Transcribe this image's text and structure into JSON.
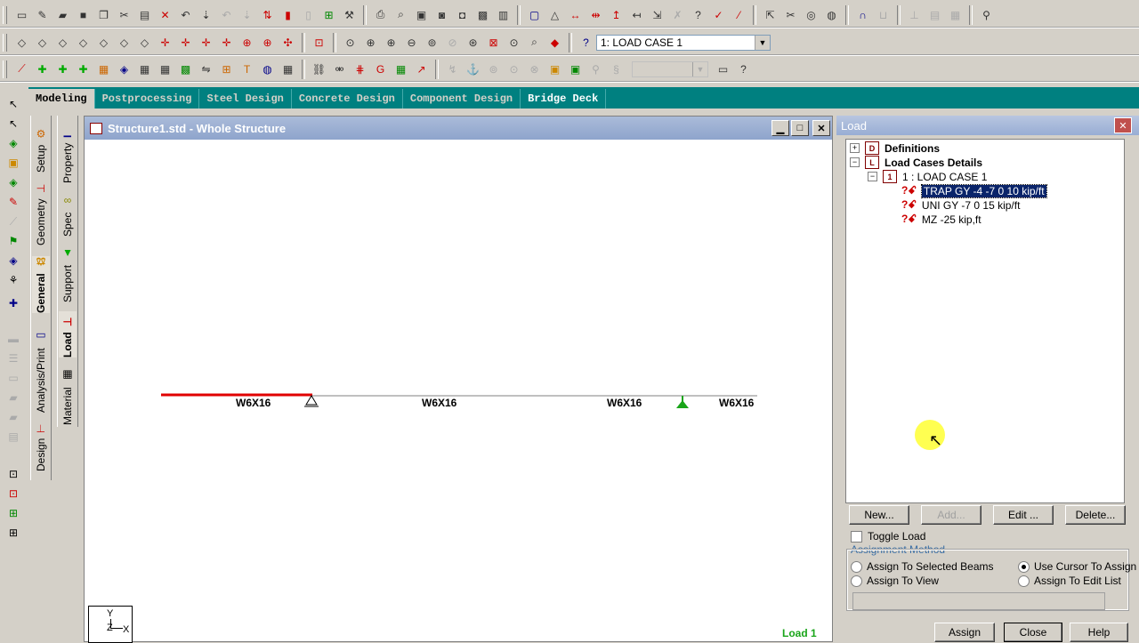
{
  "toolbar": {
    "load_case_select": "1: LOAD CASE 1",
    "icons_row1": [
      "new-file",
      "open-file",
      "open-folder",
      "save",
      "copy-doc",
      "cut",
      "paste",
      "delete",
      "undo",
      "redo-arrow",
      "undo2",
      "redo2",
      "sort",
      "clipboard",
      "list",
      "grid",
      "hammer",
      "print",
      "print-preview",
      "fax",
      "camera",
      "camera2",
      "video",
      "report",
      "window",
      "triangle-shape",
      "node-arrows",
      "dimension",
      "dimension2",
      "dimension3",
      "dimension4",
      "question",
      "chart",
      "chart2",
      "cursor",
      "scissors",
      "disk",
      "ring",
      "pipe",
      "boxes",
      "boxes2",
      "cube",
      "light"
    ],
    "icons_row2": [
      "cube1",
      "cube2",
      "cube3",
      "cube4",
      "cube5",
      "cube6",
      "pan1",
      "pan2",
      "pan3",
      "pan4",
      "pan5",
      "select-area",
      "dash",
      "fit",
      "zoom-in",
      "zoom-in2",
      "zoom-out",
      "zoom-window",
      "zoom-dynamic",
      "zoom-prev",
      "zoom-all",
      "zoom-sel",
      "zoom-field",
      "paint",
      "help-dropdown"
    ],
    "icons_row3": [
      "add-beam",
      "add-node",
      "add-plate",
      "add-solid",
      "mesh",
      "move",
      "rotate",
      "mirror",
      "split",
      "merge",
      "insert",
      "text",
      "globe",
      "table",
      "tool1",
      "tool2",
      "tool3",
      "tool4",
      "tool5",
      "tool6",
      "tool7",
      "tool8",
      "tool9",
      "tool10",
      "tool11",
      "tool12",
      "tool13",
      "tool14",
      "tool15",
      "monitor",
      "help"
    ]
  },
  "page_tabs": [
    {
      "label": "Modeling",
      "active": true
    },
    {
      "label": "Postprocessing"
    },
    {
      "label": "Steel Design"
    },
    {
      "label": "Concrete Design"
    },
    {
      "label": "Component Design"
    },
    {
      "label": "Bridge Deck",
      "bright": true
    }
  ],
  "side_tabs_outer": [
    "Setup",
    "Geometry",
    "General",
    "Analysis/Print",
    "Design"
  ],
  "side_tabs_inner": [
    "Property",
    "Spec",
    "Support",
    "Load",
    "Material"
  ],
  "structure_window": {
    "title": "Structure1.std - Whole Structure",
    "beam_labels": [
      "W6X16",
      "W6X16",
      "W6X16",
      "W6X16"
    ],
    "status_label": "Load 1",
    "axis_y": "Y",
    "axis_x": "X",
    "axis_z": "Z"
  },
  "load_panel": {
    "title": "Load",
    "tree": {
      "definitions": "Definitions",
      "load_cases_details": "Load Cases Details",
      "load_case": "1 : LOAD CASE 1",
      "items": [
        "TRAP GY -4 -7 0 10 kip/ft",
        "UNI GY -7 0 15 kip/ft",
        "MZ -25 kip,ft"
      ]
    },
    "buttons": {
      "new": "New...",
      "add": "Add...",
      "edit": "Edit ...",
      "delete": "Delete..."
    },
    "toggle_load": "Toggle Load",
    "assignment_method": "Assignment Method",
    "options": {
      "selected_beams": "Assign To Selected Beams",
      "use_cursor": "Use Cursor To Assign",
      "to_view": "Assign To View",
      "edit_list": "Assign To Edit List"
    },
    "bottom_buttons": {
      "assign": "Assign",
      "close": "Close",
      "help": "Help"
    }
  },
  "colors": {
    "teal": "#008080",
    "load_red": "#e00000",
    "support_green": "#1aa51a",
    "status_green": "#1aa51a",
    "cursor_highlight": "#ffff33"
  }
}
